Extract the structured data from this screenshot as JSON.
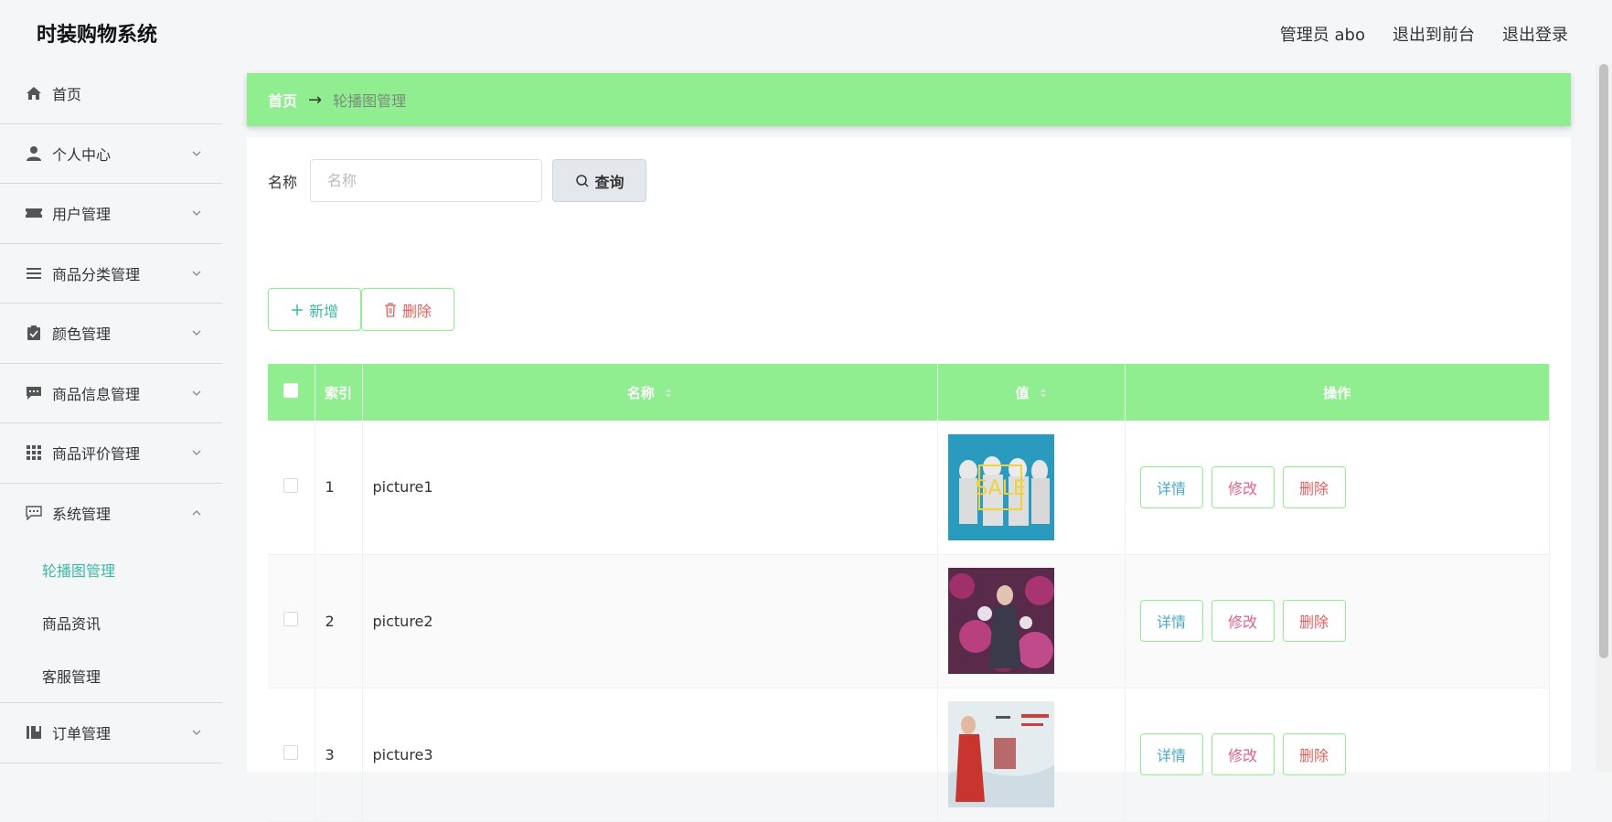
{
  "app": {
    "title": "时装购物系统"
  },
  "header": {
    "user": "管理员 abo",
    "front": "退出到前台",
    "logout": "退出登录"
  },
  "sidebar": {
    "items": [
      {
        "label": "首页",
        "icon": "home-icon"
      },
      {
        "label": "个人中心",
        "icon": "user-icon"
      },
      {
        "label": "用户管理",
        "icon": "ticket-icon"
      },
      {
        "label": "商品分类管理",
        "icon": "list-icon"
      },
      {
        "label": "颜色管理",
        "icon": "clipboard-icon"
      },
      {
        "label": "商品信息管理",
        "icon": "chat-icon"
      },
      {
        "label": "商品评价管理",
        "icon": "grid-icon"
      },
      {
        "label": "系统管理",
        "icon": "message-icon"
      },
      {
        "label": "订单管理",
        "icon": "book-icon"
      }
    ],
    "system_sub": [
      "轮播图管理",
      "商品资讯",
      "客服管理"
    ]
  },
  "breadcrumb": {
    "home": "首页",
    "arrow": "→",
    "current": "轮播图管理"
  },
  "search": {
    "label": "名称",
    "placeholder": "名称",
    "button": "查询"
  },
  "actions": {
    "add": "新增",
    "delete": "删除"
  },
  "table": {
    "headers": {
      "index": "索引",
      "name": "名称",
      "value": "值",
      "ops": "操作"
    },
    "rows": [
      {
        "index": "1",
        "name": "picture1",
        "thumb_text": "SALE"
      },
      {
        "index": "2",
        "name": "picture2"
      },
      {
        "index": "3",
        "name": "picture3"
      }
    ],
    "row_buttons": {
      "detail": "详情",
      "edit": "修改",
      "remove": "删除"
    }
  },
  "colors": {
    "accent": "#90ee90",
    "active": "#3cb8a5"
  }
}
